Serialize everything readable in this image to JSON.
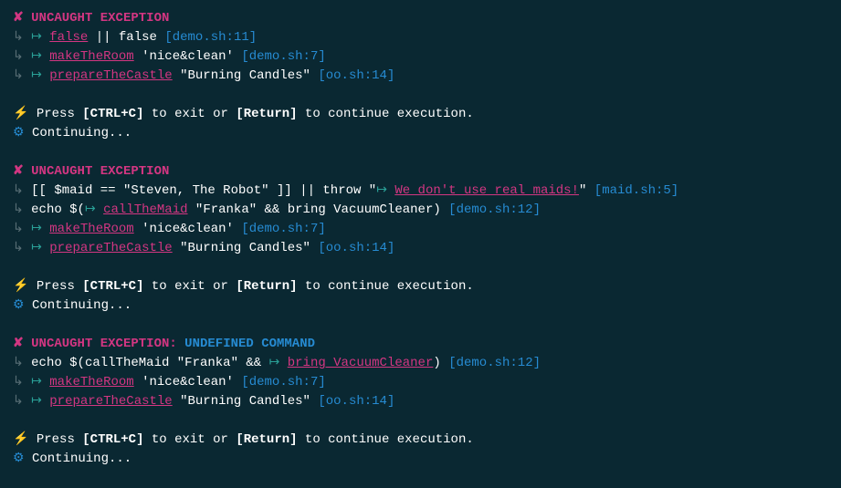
{
  "blocks": [
    {
      "header": {
        "title": "UNCAUGHT EXCEPTION",
        "subtitle": null
      },
      "frames": [
        {
          "indent": 1,
          "prefix": "",
          "highlight": "false",
          "suffix": " || false",
          "loc": "[demo.sh:11]"
        },
        {
          "indent": 2,
          "prefix": "",
          "highlight": "makeTheRoom",
          "suffix": " 'nice&clean'",
          "loc": "[demo.sh:7]"
        },
        {
          "indent": 3,
          "prefix": "",
          "highlight": "prepareTheCastle",
          "suffix": " \"Burning Candles\"",
          "loc": "[oo.sh:14]"
        }
      ]
    },
    {
      "header": {
        "title": "UNCAUGHT EXCEPTION",
        "subtitle": null
      },
      "frames": [
        {
          "indent": 1,
          "prefix": "[[ $maid == \"Steven, The Robot\" ]] || throw \"",
          "highlight": "We don't use real maids!",
          "suffix": "\"",
          "loc": "[maid.sh:5]",
          "prefixHasArrow": true
        },
        {
          "indent": 2,
          "prefix": "echo $(",
          "highlight": "callTheMaid",
          "suffix": " \"Franka\" && bring VacuumCleaner)",
          "loc": "[demo.sh:12]",
          "prefixHasArrow": true
        },
        {
          "indent": 3,
          "prefix": "",
          "highlight": "makeTheRoom",
          "suffix": " 'nice&clean'",
          "loc": "[demo.sh:7]"
        },
        {
          "indent": 4,
          "prefix": "",
          "highlight": "prepareTheCastle",
          "suffix": " \"Burning Candles\"",
          "loc": "[oo.sh:14]"
        }
      ]
    },
    {
      "header": {
        "title": "UNCAUGHT EXCEPTION:",
        "subtitle": " UNDEFINED COMMAND"
      },
      "frames": [
        {
          "indent": 1,
          "prefix": "echo $(callTheMaid \"Franka\" && ",
          "highlight": "bring VacuumCleaner",
          "suffix": ")",
          "loc": "[demo.sh:12]",
          "prefixHasArrow": true
        },
        {
          "indent": 2,
          "prefix": "",
          "highlight": "makeTheRoom",
          "suffix": " 'nice&clean'",
          "loc": "[demo.sh:7]"
        },
        {
          "indent": 3,
          "prefix": "",
          "highlight": "prepareTheCastle",
          "suffix": " \"Burning Candles\"",
          "loc": "[oo.sh:14]"
        }
      ]
    }
  ],
  "prompt": {
    "pre": "Press ",
    "key1": "[CTRL+C]",
    "mid": " to exit or ",
    "key2": "[Return]",
    "post": " to continue execution.",
    "continuing": "Continuing..."
  },
  "glyphs": {
    "x": "✘",
    "bolt": "⚡",
    "gear": "⚙",
    "tree": "↳",
    "arrow": "↦"
  }
}
